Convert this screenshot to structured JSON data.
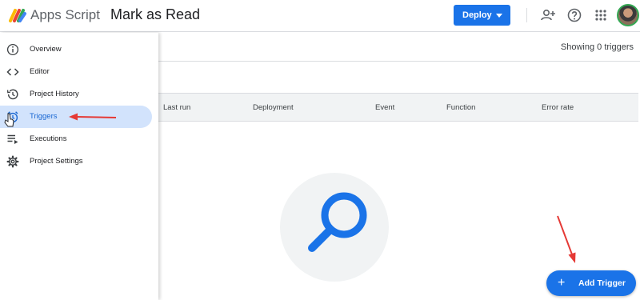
{
  "header": {
    "app_name": "Apps Script",
    "project_name": "Mark as Read",
    "deploy_label": "Deploy"
  },
  "sidebar": {
    "items": [
      {
        "label": "Overview",
        "icon": "info-icon"
      },
      {
        "label": "Editor",
        "icon": "code-icon"
      },
      {
        "label": "Project History",
        "icon": "history-icon"
      },
      {
        "label": "Triggers",
        "icon": "alarm-icon",
        "active": true
      },
      {
        "label": "Executions",
        "icon": "executions-icon"
      },
      {
        "label": "Project Settings",
        "icon": "gear-icon"
      }
    ]
  },
  "main": {
    "showing_text": "Showing 0 triggers",
    "columns": [
      "Last run",
      "Deployment",
      "Event",
      "Function",
      "Error rate"
    ],
    "add_trigger_label": "Add Trigger"
  },
  "colors": {
    "accent": "#1a73e8",
    "active_nav_bg": "#d2e3fc",
    "annotation_arrow": "#e53935"
  }
}
